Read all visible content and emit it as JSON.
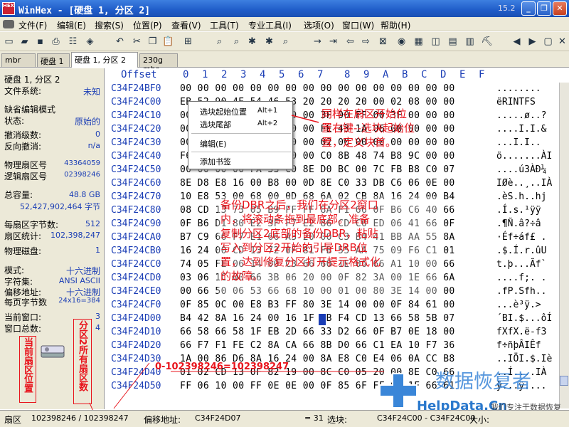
{
  "window": {
    "title": "WinHex - [硬盘 1, 分区 2]",
    "version": "15.2",
    "app_icon": "HEX"
  },
  "menu": [
    "文件(F)",
    "编辑(E)",
    "搜索(S)",
    "位置(P)",
    "查看(V)",
    "工具(T)",
    "专业工具(I)",
    "选项(O)",
    "窗口(W)",
    "帮助(H)"
  ],
  "tabs": [
    "mbr",
    "硬盘 1",
    "硬盘 1, 分区 2",
    "230g mbr"
  ],
  "info": {
    "title": "硬盘 1, 分区 2",
    "fs_label": "文件系统:",
    "fs_value": "未知",
    "mode_label": "缺省编辑模式",
    "state_label": "状态:",
    "state_value": "原始的",
    "undo_label": "撤消级数:",
    "undo_value": "0",
    "redo_label": "反向撤消:",
    "redo_value": "n/a",
    "phys_label": "物理扇区号",
    "phys_value": "43364059",
    "log_label": "逻辑扇区号",
    "log_value": "02398246",
    "cap_label": "总容量:",
    "cap_value": "48.8 GB",
    "cap_bytes": "52,427,902,464 字节",
    "bps_label": "每扇区字节数:",
    "bps_value": "512",
    "sc_label": "扇区统计:",
    "sc_value": "102,398,247",
    "pd_label": "物理磁盘:",
    "pd_value": "1",
    "m_label": "模式:",
    "m_value": "十六进制",
    "cs_label": "字符集:",
    "cs_value": "ANSI ASCII",
    "ofs_label": "偏移地址:",
    "ofs_value": "十六进制",
    "bpp_label": "每页字节数",
    "bpp_value": "24x16=384",
    "cw_label": "当前窗口:",
    "cw_value": "3",
    "tw_label": "窗口总数:",
    "tw_value": "4"
  },
  "hex_header": {
    "offset": "Offset",
    "cols": [
      "0",
      "1",
      "2",
      "3",
      "4",
      "5",
      "6",
      "7",
      "8",
      "9",
      "A",
      "B",
      "C",
      "D",
      "E",
      "F"
    ]
  },
  "hex_rows": [
    {
      "off": "C34F24BF0",
      "hex": "00 00 00 00 00 00 00 00 00 00 00 00 00 00 00 00",
      "txt": "........"
    },
    {
      "off": "C34F24C00",
      "hex": "EB 52 90 4E 54 46 53 20 20 20 20 00 02 08 00 00",
      "txt": "ëRINTFS"
    },
    {
      "off": "C34F24C10",
      "hex": "00 00 00 00 00 F8 00 00 3F 00 FF 00 3F 00 00 00",
      "txt": ".....ø..?"
    },
    {
      "off": "C34F24C20",
      "hex": "00 00 00 00 80 00 80 00 FE 43 1A 06 00 00 00 00",
      "txt": "....I.I.&"
    },
    {
      "off": "C34F24C30",
      "hex": "00 00 0C 00 00 00 00 00 02 00 00 00 00 00 00 00",
      "txt": "...I.I.."
    },
    {
      "off": "C34F24C40",
      "hex": "F6 00 00 00 01 00 00 00 C0 8B 48 74 B8 9C 00 00",
      "txt": "ö.......ÀI"
    },
    {
      "off": "C34F24C50",
      "hex": "00 00 00 00 FA 33 C0 8E D0 BC 00 7C FB B8 C0 07",
      "txt": "....ú3ÀÐ¼"
    },
    {
      "off": "C34F24C60",
      "hex": "8E D8 E8 16 00 B8 00 0D 8E C0 33 DB C6 06 0E 00",
      "txt": "IØè..¸..IÀ"
    },
    {
      "off": "C34F24C70",
      "hex": "10 E8 53 00 68 00 0D 68 6A 02 CB 8A 16 24 00 B4",
      "txt": ".èS.h..hj"
    },
    {
      "off": "C34F24C80",
      "hex": "08 CD 13 73 05 B9 FF FF 8A F1 66 0F B6 C6 40 66",
      "txt": ".Í.s.¹ÿÿ"
    },
    {
      "off": "C34F24C90",
      "hex": "0F B6 D1 80 E2 3F F7 E2 86 CD C0 ED 06 41 66 0F",
      "txt": ".¶Ñ.â?÷â"
    },
    {
      "off": "C34F24CA0",
      "hex": "B7 C9 66 F7 E1 66 A3 20 00 C3 B4 41 BB AA 55 8A",
      "txt": "·Éf÷áf£ ."
    },
    {
      "off": "C34F24CB0",
      "hex": "16 24 00 CD 13 72 0F 81 FB 55 AA 75 09 F6 C1 01",
      "txt": ".$.Í.r.ûU"
    },
    {
      "off": "C34F24CC0",
      "hex": "74 05 FE 06 14 00 C3 66 60 1E 06 66 A1 10 00 66",
      "txt": "t.þ...Ãf`"
    },
    {
      "off": "C34F24CD0",
      "hex": "03 06 1C 00 66 3B 06 20 00 0F 82 3A 00 1E 66 6A",
      "txt": "....f;. ."
    },
    {
      "off": "C34F24CE0",
      "hex": "00 66 50 06 53 66 68 10 00 01 00 80 3E 14 00 00",
      "txt": ".fP.Sfh.."
    },
    {
      "off": "C34F24CF0",
      "hex": "0F 85 0C 00 E8 B3 FF 80 3E 14 00 00 0F 84 61 00",
      "txt": "...è³ÿ.>"
    },
    {
      "off": "C34F24D00",
      "hex": "B4 42 8A 16 24 00 16 1F 8B F4 CD 13 66 58 5B 07",
      "txt": "´BI.$...ôÍ"
    },
    {
      "off": "C34F24D10",
      "hex": "66 58 66 58 1F EB 2D 66 33 D2 66 0F B7 0E 18 00",
      "txt": "fXfX.ë-f3"
    },
    {
      "off": "C34F24D20",
      "hex": "66 F7 F1 FE C2 8A CA 66 8B D0 66 C1 EA 10 F7 36",
      "txt": "f÷ñþÂIÊf"
    },
    {
      "off": "C34F24D30",
      "hex": "1A 00 86 D6 8A 16 24 00 8A E8 C0 E4 06 0A CC B8",
      "txt": "..IÖI.$.Iè"
    },
    {
      "off": "C34F24D40",
      "hex": "01 02 CD 13 0F 82 19 00 8C C0 05 20 00 8E C0 66",
      "txt": "..Í....IÀ"
    },
    {
      "off": "C34F24D50",
      "hex": "FF 06 10 00 FF 0E 0E 00 0F 85 6F FF 07 1F 66 61",
      "txt": "ÿ...ÿ...."
    }
  ],
  "context_menu": [
    {
      "label": "选块起始位置",
      "key": "Alt+1"
    },
    {
      "label": "选块尾部",
      "key": "Alt+2"
    },
    {
      "label": "编辑(E)",
      "key": ""
    },
    {
      "label": "添加书签",
      "key": ""
    }
  ],
  "annotations": {
    "top": [
      "同样在扇区开始位",
      "置右键--选块起始位",
      "置，定义块首。"
    ],
    "middle": [
      "备份DBR之后，我们在分区2窗口",
      "内，将滚动条拖到最底部。准备",
      "复制分区2底部的备份DBR，粘贴",
      "写入到分区2开始的引导DRB位",
      "置，达到修复分区打开提示格式化",
      "的故障。"
    ],
    "formula": "0-102398246=102398247",
    "left_vertical": "当前扇区位置",
    "right_vertical": "分区2所有扇区数"
  },
  "statusbar": {
    "sector_label": "扇区",
    "sector_value": "102398246 / 102398247",
    "offset_label": "偏移地址:",
    "offset_value": "C34F24D07",
    "eq": "= 31",
    "block_label": "选块:",
    "block_value": "C34F24C00 - C34F24C00",
    "size_label": "大小:"
  },
  "watermark": {
    "cn": "数据恢复者",
    "url": "HelpData.Cn",
    "slogan": "我们专注于数据恢复"
  },
  "colors": {
    "accent": "#1a3db5",
    "annotation": "#e8141c",
    "title_bar": "#1f5cc8"
  }
}
